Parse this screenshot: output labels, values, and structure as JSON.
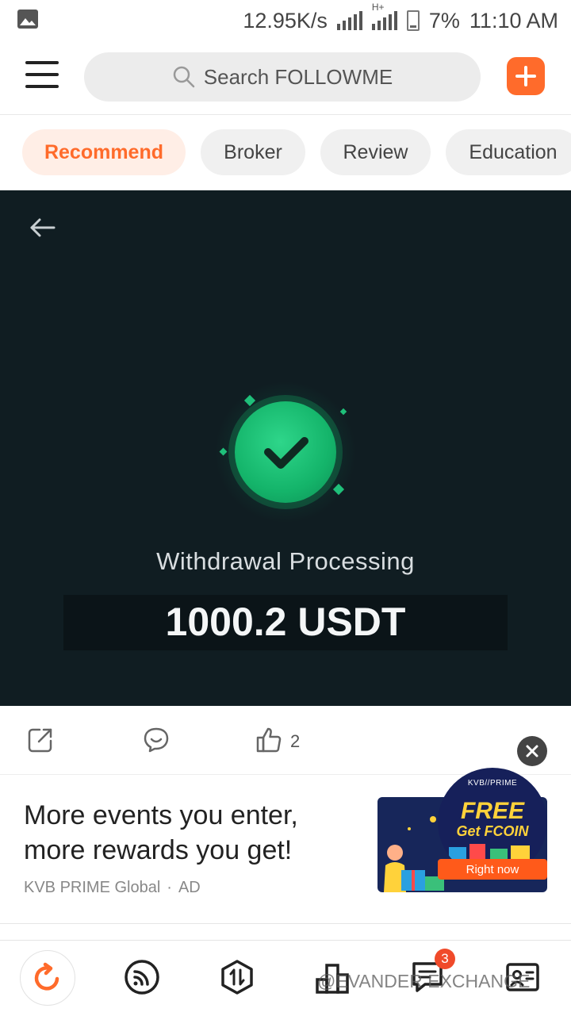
{
  "status_bar": {
    "net_speed": "12.95K/s",
    "network_label": "H+",
    "battery": "7%",
    "time": "11:10 AM"
  },
  "header": {
    "search_placeholder": "Search FOLLOWME"
  },
  "tabs": [
    {
      "label": "Recommend",
      "active": true
    },
    {
      "label": "Broker",
      "active": false
    },
    {
      "label": "Review",
      "active": false
    },
    {
      "label": "Education",
      "active": false
    }
  ],
  "post_image": {
    "title": "Withdrawal Processing",
    "amount": "1000.2 USDT"
  },
  "actions": {
    "like_count": "2"
  },
  "ad": {
    "headline": "More events you enter, more rewards you get!",
    "source": "KVB PRIME Global",
    "tag": "AD",
    "promo_brand": "KVB//PRIME",
    "promo_title": "FREE",
    "promo_subtitle": "Get FCOIN",
    "promo_button": "Right now"
  },
  "bottom_nav": {
    "messages_badge": "3",
    "watermark": "@EVANDER EXCHANGE"
  },
  "colors": {
    "accent": "#ff6b2b",
    "hero_bg": "#101d22",
    "success": "#1fc07a"
  }
}
